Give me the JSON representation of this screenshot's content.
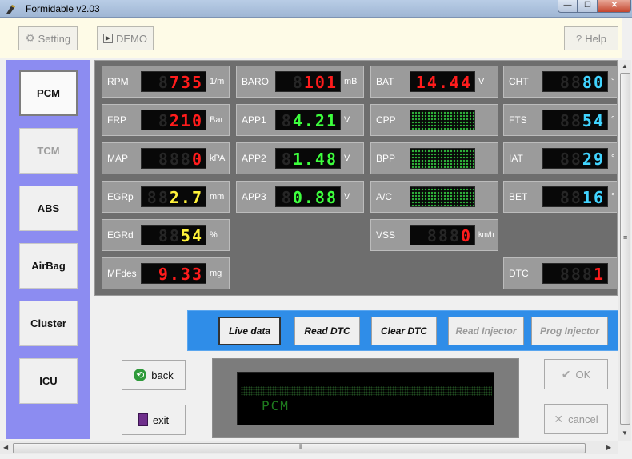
{
  "window": {
    "title": "Formidable v2.03"
  },
  "caption": {
    "minimize": "—",
    "maximize": "☐",
    "close": "✕"
  },
  "toolbar": {
    "setting": "Setting",
    "demo": "DEMO",
    "help": "Help"
  },
  "sidebar": {
    "items": [
      {
        "label": "PCM",
        "state": "active"
      },
      {
        "label": "TCM",
        "state": "disabled"
      },
      {
        "label": "ABS",
        "state": "normal"
      },
      {
        "label": "AirBag",
        "state": "normal"
      },
      {
        "label": "Cluster",
        "state": "normal"
      },
      {
        "label": "ICU",
        "state": "normal"
      }
    ]
  },
  "gauges": {
    "rpm": {
      "label": "RPM",
      "value": "735",
      "unit": "1/m",
      "color": "#ff1c1c"
    },
    "frp": {
      "label": "FRP",
      "value": "210",
      "unit": "Bar",
      "color": "#ff1c1c"
    },
    "map": {
      "label": "MAP",
      "value": "0",
      "unit": "kPA",
      "color": "#ff1c1c"
    },
    "egrp": {
      "label": "EGRp",
      "value": "2.7",
      "unit": "mm",
      "color": "#fff23a"
    },
    "egrd": {
      "label": "EGRd",
      "value": "54",
      "unit": "%",
      "color": "#fff23a"
    },
    "mfdes": {
      "label": "MFdes",
      "value": "9.33",
      "unit": "mg",
      "color": "#ff1c1c"
    },
    "baro": {
      "label": "BARO",
      "value": "101",
      "unit": "mB",
      "color": "#ff1c1c"
    },
    "app1": {
      "label": "APP1",
      "value": "4.21",
      "unit": "V",
      "color": "#3dff3d"
    },
    "app2": {
      "label": "APP2",
      "value": "1.48",
      "unit": "V",
      "color": "#3dff3d"
    },
    "app3": {
      "label": "APP3",
      "value": "0.88",
      "unit": "V",
      "color": "#3dff3d"
    },
    "bat": {
      "label": "BAT",
      "value": "14.44",
      "unit": "V",
      "color": "#ff1c1c"
    },
    "cpp": {
      "label": "CPP"
    },
    "bpp": {
      "label": "BPP"
    },
    "ac": {
      "label": "A/C"
    },
    "vss": {
      "label": "VSS",
      "value": "0",
      "unit": "km/h",
      "color": "#ff1c1c"
    },
    "cht": {
      "label": "CHT",
      "value": "80",
      "unit": "°",
      "color": "#41d4ff"
    },
    "fts": {
      "label": "FTS",
      "value": "54",
      "unit": "°",
      "color": "#41d4ff"
    },
    "iat": {
      "label": "IAT",
      "value": "29",
      "unit": "°",
      "color": "#41d4ff"
    },
    "bet": {
      "label": "BET",
      "value": "16",
      "unit": "°",
      "color": "#41d4ff"
    },
    "dtc": {
      "label": "DTC",
      "value": "1",
      "unit": "",
      "color": "#ff1c1c"
    }
  },
  "commands": {
    "live_data": "Live data",
    "read_dtc": "Read DTC",
    "clear_dtc": "Clear DTC",
    "read_injector": "Read Injector",
    "prog_injector": "Prog Injector"
  },
  "bottom": {
    "back": "back",
    "exit": "exit",
    "ok": "OK",
    "cancel": "cancel"
  },
  "lcd": {
    "line2": "PCM"
  }
}
